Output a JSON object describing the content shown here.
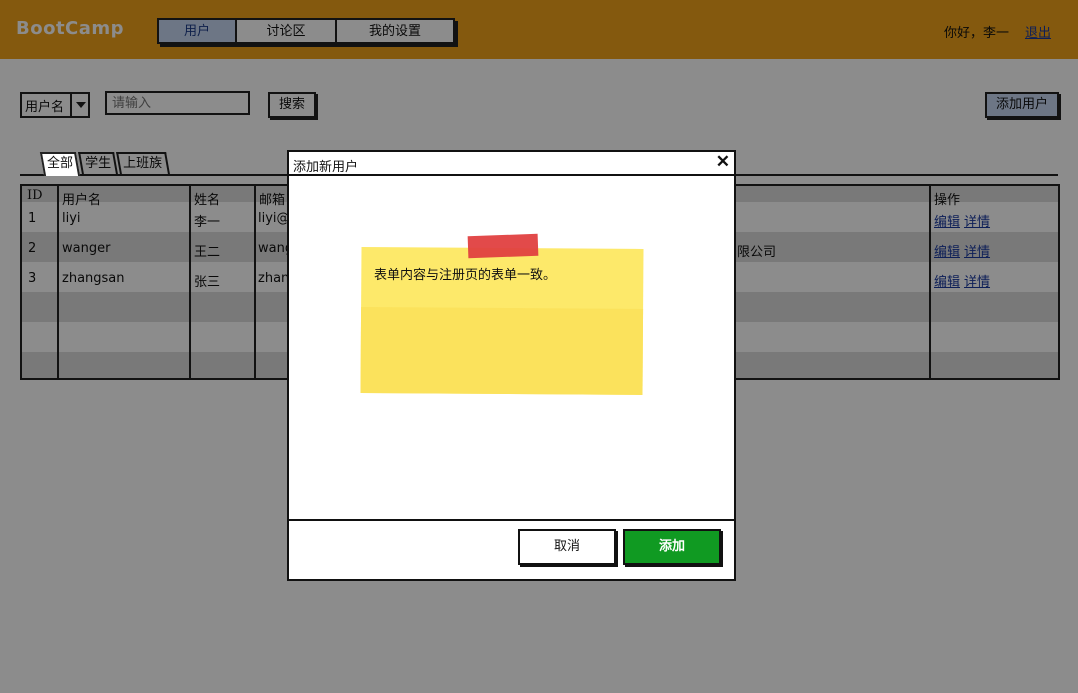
{
  "app": {
    "logo": "BootCamp"
  },
  "nav": {
    "tabs": [
      "用户",
      "讨论区",
      "我的设置"
    ],
    "active_index": 0
  },
  "user": {
    "greeting": "你好，李一",
    "logout_label": "退出"
  },
  "toolbar": {
    "filter_field": "用户名",
    "search_placeholder": "请输入",
    "search_label": "搜索",
    "add_user_label": "添加用户"
  },
  "content_tabs": {
    "tabs": [
      "全部",
      "学生",
      "上班族"
    ],
    "active_index": 0
  },
  "table": {
    "columns": [
      "ID",
      "用户名",
      "姓名",
      "邮箱",
      "操作"
    ],
    "rows": [
      {
        "id": "1",
        "username": "liyi",
        "name": "李一",
        "email": "liyi@",
        "company": "",
        "edit": "编辑",
        "detail": "详情"
      },
      {
        "id": "2",
        "username": "wanger",
        "name": "王二",
        "email": "wang",
        "company": "限公司",
        "edit": "编辑",
        "detail": "详情"
      },
      {
        "id": "3",
        "username": "zhangsan",
        "name": "张三",
        "email": "zhan",
        "company": "",
        "edit": "编辑",
        "detail": "详情"
      }
    ]
  },
  "modal": {
    "title": "添加新用户",
    "note": "表单内容与注册页的表单一致。",
    "cancel_label": "取消",
    "confirm_label": "添加"
  },
  "colors": {
    "header": "#f0a21a",
    "active_tab": "#c6d8f2",
    "confirm": "#109a22",
    "sticky_note": "#fde96a",
    "tape": "#e04040"
  }
}
